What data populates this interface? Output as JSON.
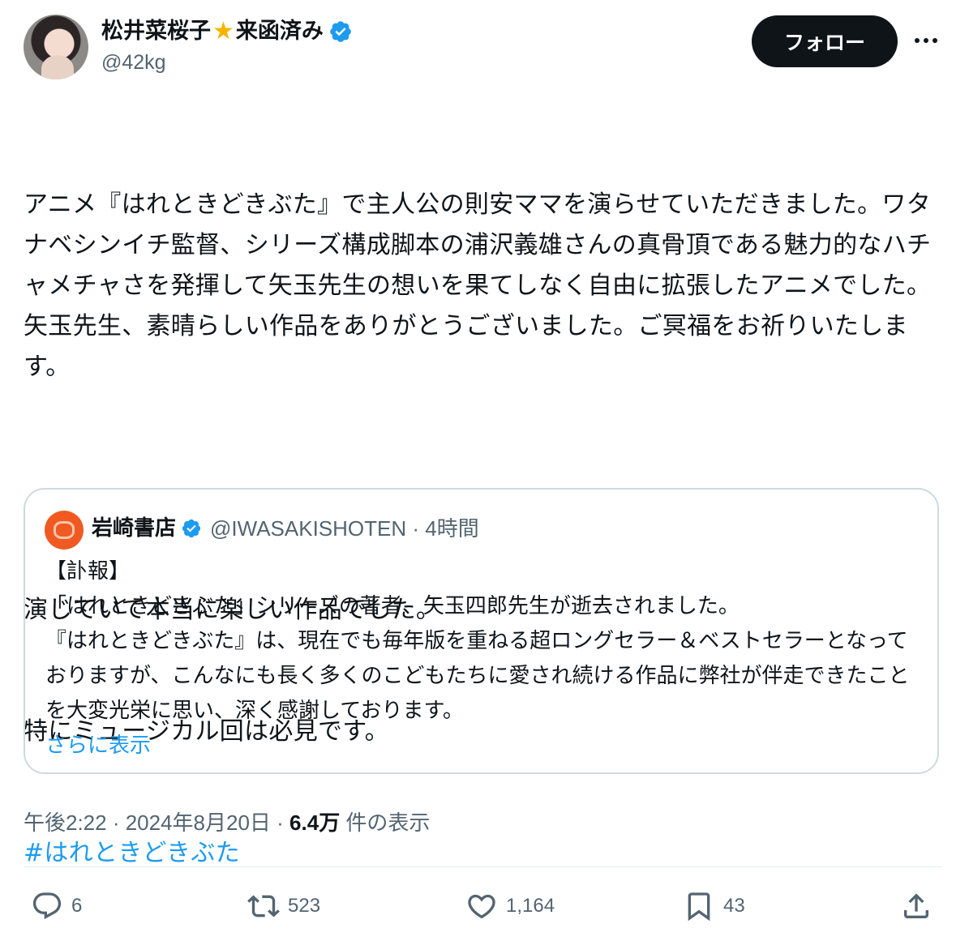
{
  "author": {
    "name_part1": "松井菜桜子",
    "star": "★",
    "name_part2": "来函済み",
    "handle": "@42kg",
    "verified_icon": "verified-badge-icon"
  },
  "follow_label": "フォロー",
  "tweet": {
    "paragraph1": "アニメ『はれときどきぶた』で主人公の則安ママを演らせていただきました。ワタナベシンイチ監督、シリーズ構成脚本の浦沢義雄さんの真骨頂である魅力的なハチャメチャさを発揮して矢玉先生の想いを果てしなく自由に拡張したアニメでした。矢玉先生、素晴らしい作品をありがとうございました。ご冥福をお祈りいたします。",
    "line2": "演じていて本当に楽しい作品でした。",
    "line3": "特にミュージカル回は必見です。",
    "hashtag": "#はれときどきぶた"
  },
  "quote": {
    "name": "岩崎書店",
    "handle_time": "@IWASAKISHOTEN · 4時間",
    "line1": "【訃報】",
    "line2": "「はれときどきぶた」シリーズの著者、矢玉四郎先生が逝去されました。",
    "line3": "『はれときどきぶた』は、現在でも毎年版を重ねる超ロングセラー＆ベストセラーとなっておりますが、こんなにも長く多くのこどもたちに愛され続ける作品に弊社が伴走できたことを大変光栄に思い、深く感謝しております。",
    "show_more": "さらに表示"
  },
  "meta": {
    "time_date": "午後2:22 · 2024年8月20日 · ",
    "views_count": "6.4万",
    "views_label": " 件の表示"
  },
  "actions": {
    "replies": "6",
    "reposts": "523",
    "likes": "1,164",
    "bookmarks": "43"
  },
  "colors": {
    "accent": "#1d9bf0",
    "text": "#0f1419",
    "secondary": "#536471",
    "border": "#cfd9de",
    "star": "#f6b400"
  }
}
